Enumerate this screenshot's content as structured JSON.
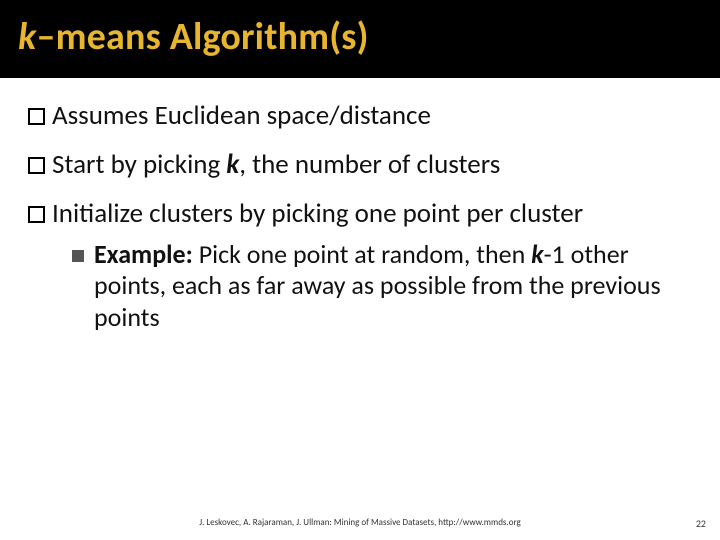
{
  "title": {
    "prefix_italic": "k",
    "rest": "–means Algorithm(s)"
  },
  "bullets": [
    {
      "text": "Assumes Euclidean space/distance"
    },
    {
      "pre": "Start by picking ",
      "kvar": "k",
      "post": ", the number of clusters"
    },
    {
      "text": "Initialize clusters by picking one point per cluster"
    }
  ],
  "sub": {
    "label": "Example:",
    "pre": " Pick one point at random, then ",
    "kvar": "k",
    "post": "-1 other points, each as far away as possible from the previous points"
  },
  "footer": "J. Leskovec, A. Rajaraman, J. Ullman: Mining of Massive Datasets, http://www.mmds.org",
  "page": "22"
}
